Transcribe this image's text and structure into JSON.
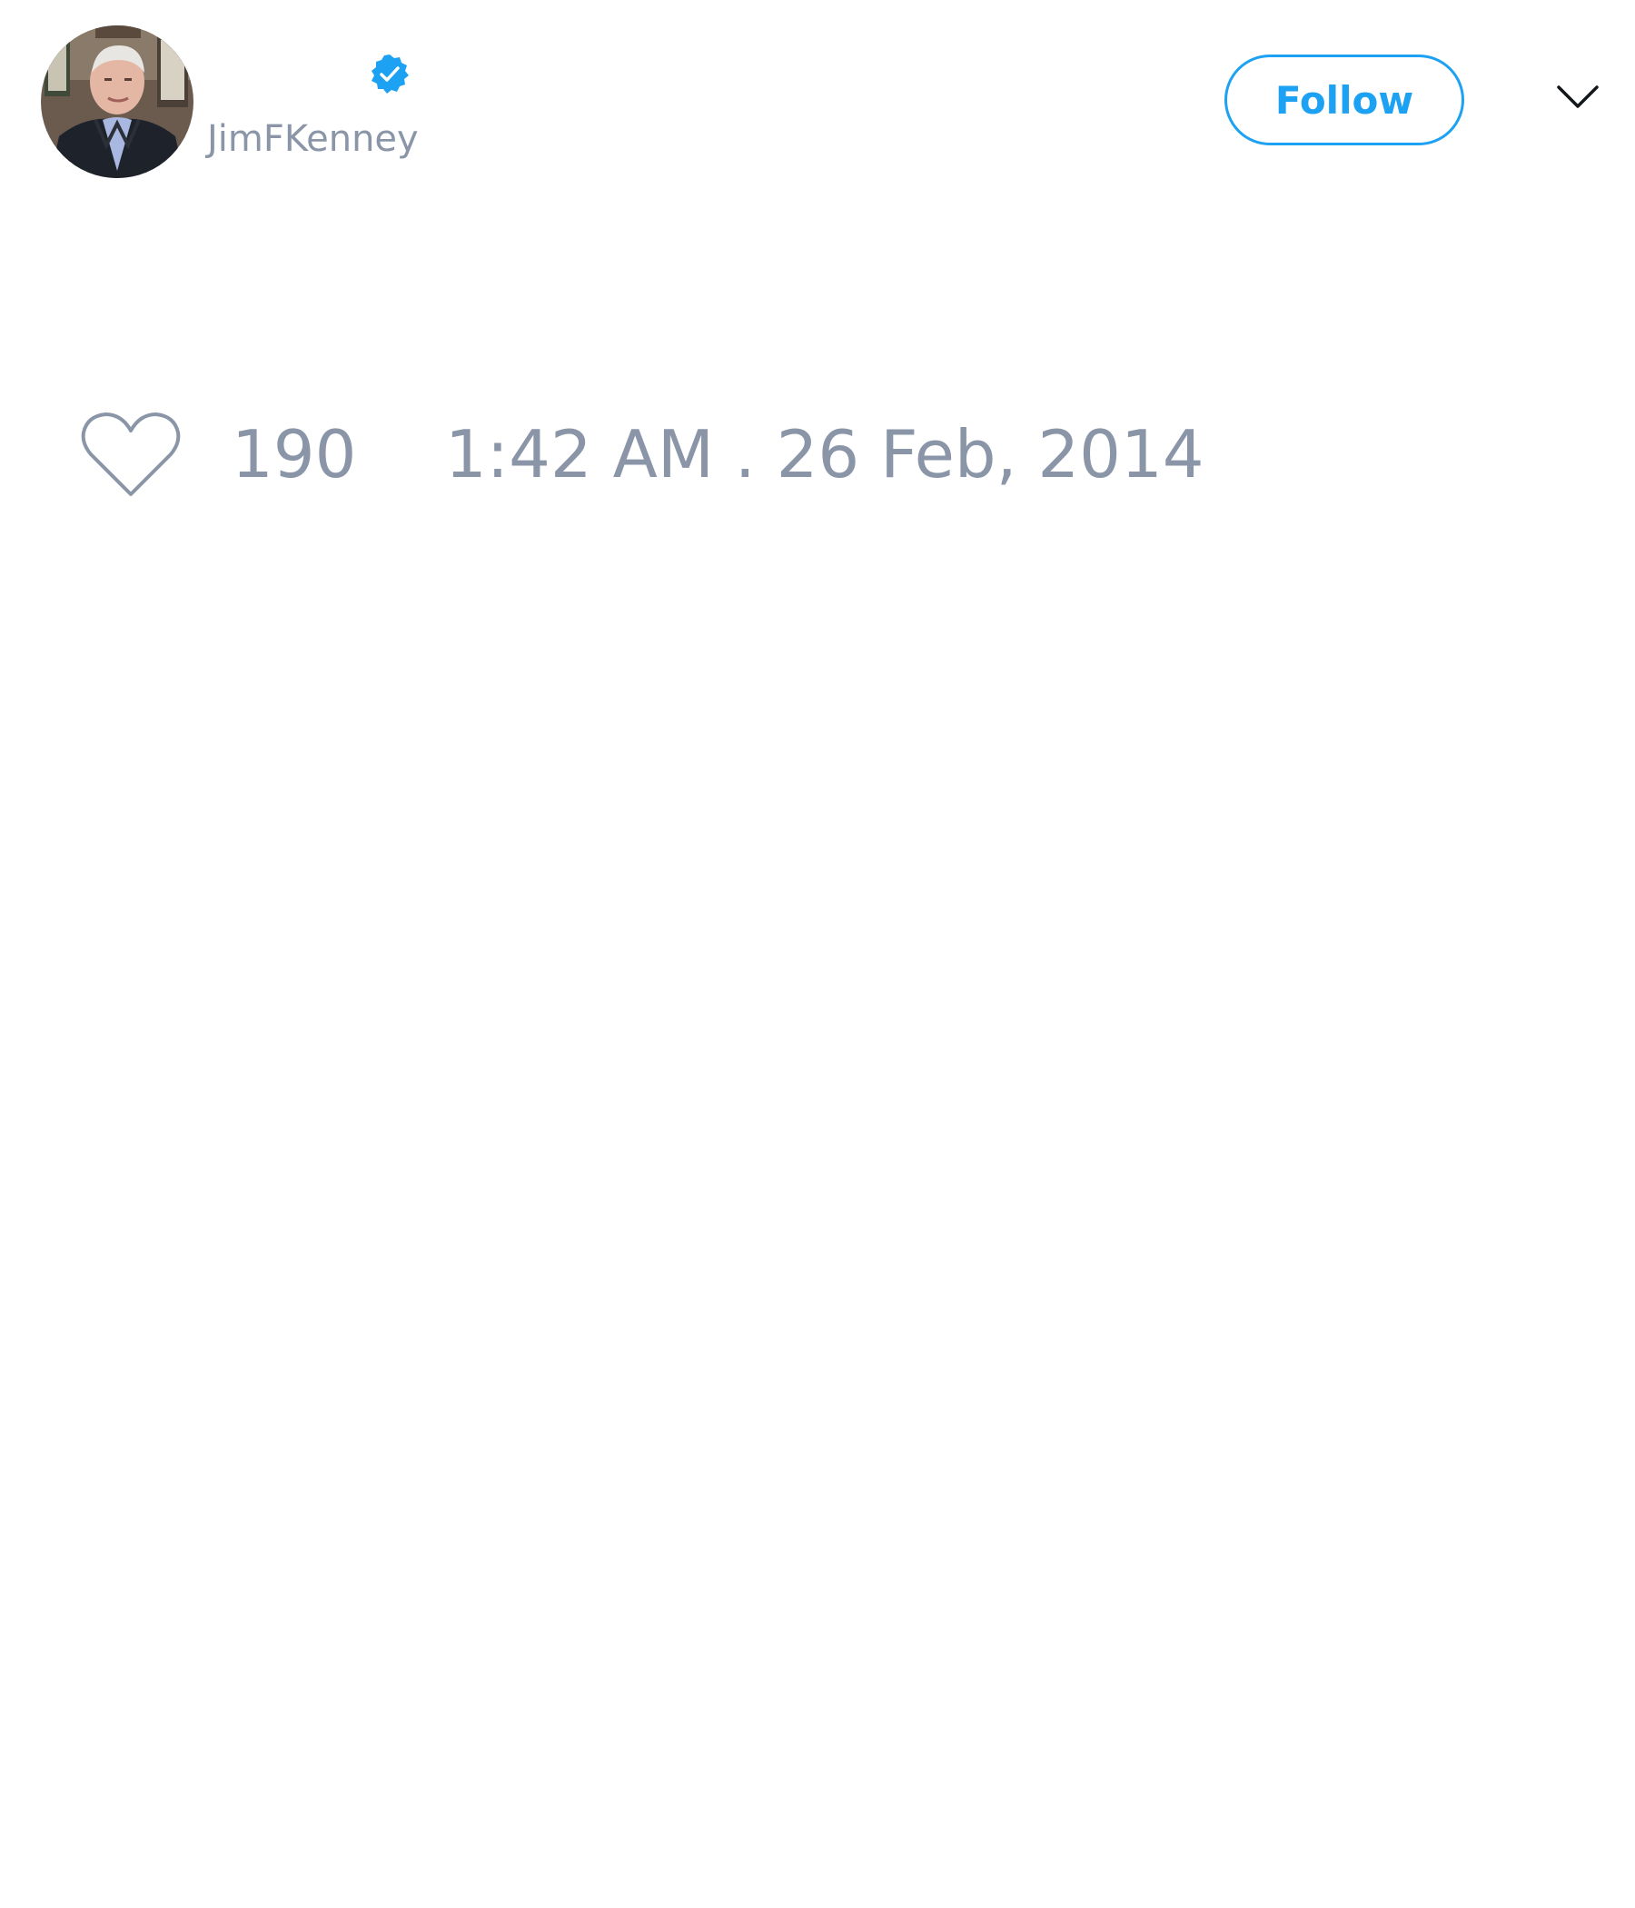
{
  "tweet": {
    "author": {
      "display_name": "",
      "handle": "JimFKenney",
      "verified": true,
      "avatar_icon": "user-avatar-photo"
    },
    "follow_label": "Follow",
    "menu_icon": "chevron-down-icon",
    "like_icon": "heart-icon",
    "like_count": "190",
    "timestamp": "1:42 AM . 26 Feb, 2014"
  },
  "colors": {
    "accent": "#1da1f2",
    "muted_text": "#8a96a8",
    "background": "#ffffff"
  }
}
